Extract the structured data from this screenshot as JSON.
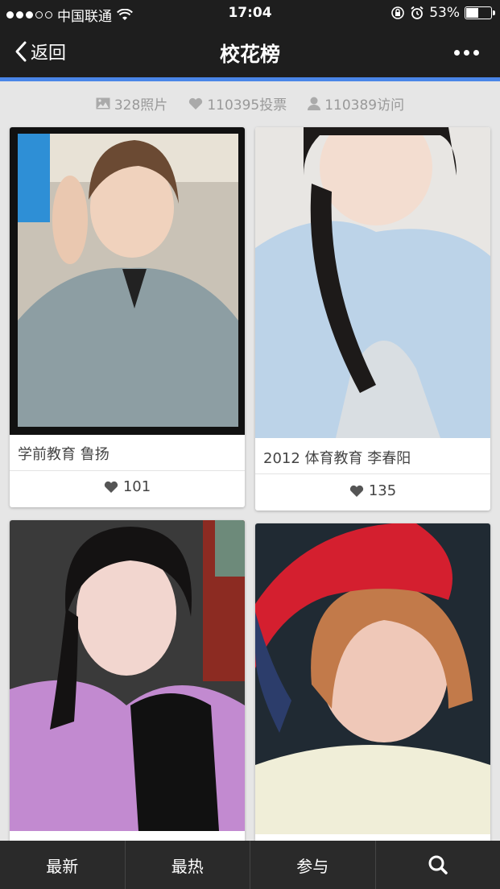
{
  "status_bar": {
    "carrier": "中国联通",
    "time": "17:04",
    "battery": "53%",
    "battery_level": 0.53
  },
  "nav": {
    "back_label": "返回",
    "title": "校花榜"
  },
  "stats": {
    "photos": "328照片",
    "votes": "110395投票",
    "visits": "110389访问"
  },
  "cards": [
    {
      "caption": "学前教育 鲁扬",
      "likes": "101"
    },
    {
      "caption": "2012 体育教育 李春阳",
      "likes": "135"
    },
    {
      "caption": "",
      "likes": ""
    },
    {
      "caption": "",
      "likes": ""
    }
  ],
  "tabs": [
    "最新",
    "最热",
    "参与"
  ],
  "colors": {
    "accent": "#4a86e8",
    "bar": "#1e1e1e",
    "tabbar": "#2a2a2a"
  }
}
